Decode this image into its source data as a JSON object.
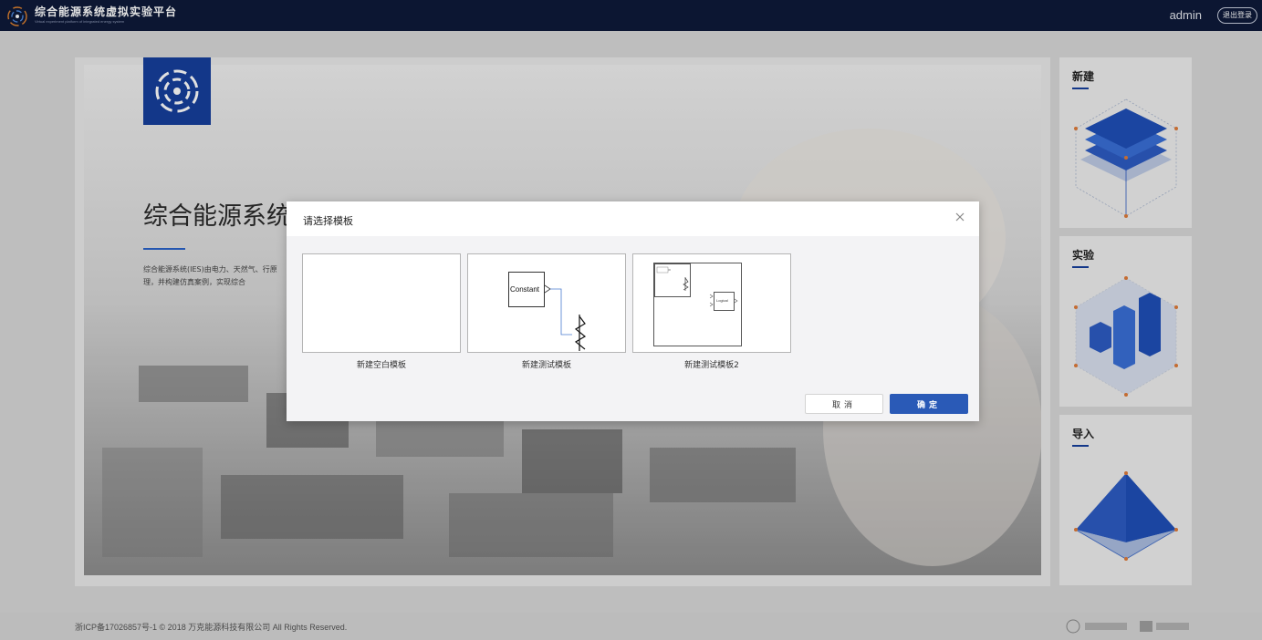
{
  "header": {
    "title": "综合能源系统虚拟实验平台",
    "subtitle": "Virtual experiment platform of integrated energy system",
    "user": "admin",
    "logout_label": "退出登录"
  },
  "hero": {
    "title": "综合能源系统虚拟实验平台",
    "description": "综合能源系统(IES)由电力、天然气、行原理，并构建仿真案例，实现综合"
  },
  "side_cards": [
    {
      "title": "新建",
      "icon": "layers-icon"
    },
    {
      "title": "实验",
      "icon": "bar-chart-icon"
    },
    {
      "title": "导入",
      "icon": "pyramid-icon"
    }
  ],
  "footer": {
    "copyright": "浙ICP备17026857号-1 © 2018 万克能源科技有限公司 All Rights Reserved."
  },
  "modal": {
    "title": "请选择模板",
    "templates": [
      {
        "label": "新建空白模板"
      },
      {
        "label": "新建测试模板",
        "block_text": "Constant"
      },
      {
        "label": "新建测试模板2",
        "block_text": "Logical"
      }
    ],
    "cancel_label": "取消",
    "ok_label": "确定"
  },
  "colors": {
    "topbar": "#0e1a3a",
    "primary": "#2a5ab7",
    "brand_blue": "#163f9d",
    "accent_orange": "#e07b39"
  }
}
